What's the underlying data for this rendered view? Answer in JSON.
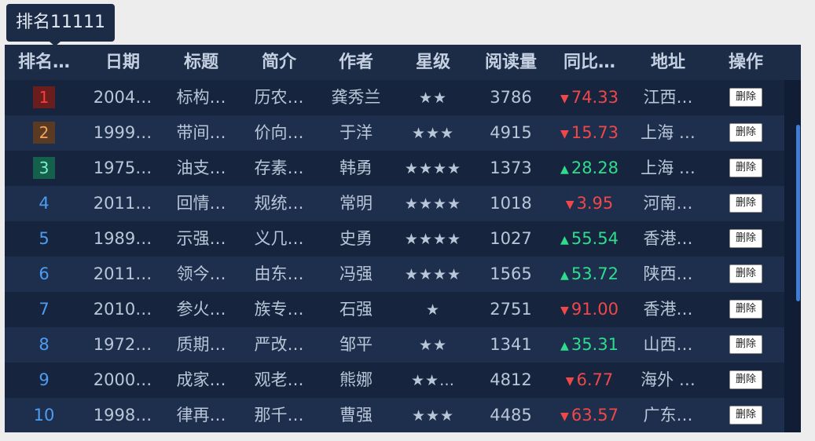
{
  "tooltip": {
    "text": "排名11111"
  },
  "headers": [
    "排名…",
    "日期",
    "标题",
    "简介",
    "作者",
    "星级",
    "阅读量",
    "同比…",
    "地址",
    "操作"
  ],
  "rows": [
    {
      "rank": "1",
      "date": "2004…",
      "title": "标构…",
      "intro": "历农…",
      "author": "龚秀兰",
      "stars": "★★",
      "reads": "3786",
      "trend": "down",
      "yoy": "74.33",
      "address": "江西…",
      "action": "删除"
    },
    {
      "rank": "2",
      "date": "1999…",
      "title": "带间…",
      "intro": "价向…",
      "author": "于洋",
      "stars": "★★★",
      "reads": "4915",
      "trend": "down",
      "yoy": "15.73",
      "address": "上海 …",
      "action": "删除"
    },
    {
      "rank": "3",
      "date": "1975…",
      "title": "油支…",
      "intro": "存素…",
      "author": "韩勇",
      "stars": "★★★★",
      "reads": "1373",
      "trend": "up",
      "yoy": "28.28",
      "address": "上海 …",
      "action": "删除"
    },
    {
      "rank": "4",
      "date": "2011…",
      "title": "回情…",
      "intro": "规统…",
      "author": "常明",
      "stars": "★★★★",
      "reads": "1018",
      "trend": "down",
      "yoy": "3.95",
      "address": "河南…",
      "action": "删除"
    },
    {
      "rank": "5",
      "date": "1989…",
      "title": "示强…",
      "intro": "义几…",
      "author": "史勇",
      "stars": "★★★★",
      "reads": "1027",
      "trend": "up",
      "yoy": "55.54",
      "address": "香港…",
      "action": "删除"
    },
    {
      "rank": "6",
      "date": "2011…",
      "title": "领今…",
      "intro": "由东…",
      "author": "冯强",
      "stars": "★★★★",
      "reads": "1565",
      "trend": "up",
      "yoy": "53.72",
      "address": "陕西…",
      "action": "删除"
    },
    {
      "rank": "7",
      "date": "2010…",
      "title": "参火…",
      "intro": "族专…",
      "author": "石强",
      "stars": "★",
      "reads": "2751",
      "trend": "down",
      "yoy": "91.00",
      "address": "香港…",
      "action": "删除"
    },
    {
      "rank": "8",
      "date": "1972…",
      "title": "质期…",
      "intro": "严改…",
      "author": "邹平",
      "stars": "★★",
      "reads": "1341",
      "trend": "up",
      "yoy": "35.31",
      "address": "山西…",
      "action": "删除"
    },
    {
      "rank": "9",
      "date": "2000…",
      "title": "成家…",
      "intro": "观老…",
      "author": "熊娜",
      "stars": "★★…",
      "reads": "4812",
      "trend": "down",
      "yoy": "6.77",
      "address": "海外 …",
      "action": "删除"
    },
    {
      "rank": "10",
      "date": "1998…",
      "title": "律再…",
      "intro": "那千…",
      "author": "曹强",
      "stars": "★★★",
      "reads": "4485",
      "trend": "down",
      "yoy": "63.57",
      "address": "广东…",
      "action": "删除"
    }
  ],
  "symbols": {
    "up": "▲",
    "down": "▼"
  },
  "colors": {
    "header_bg": "#1c2c46",
    "row_odd": "#16253d",
    "row_even": "#1d2f4c",
    "trend_up": "#2fdc8e",
    "trend_down": "#f0474a",
    "rank_link": "#4d9cf3",
    "scrollbar": "#3f7ed8"
  }
}
